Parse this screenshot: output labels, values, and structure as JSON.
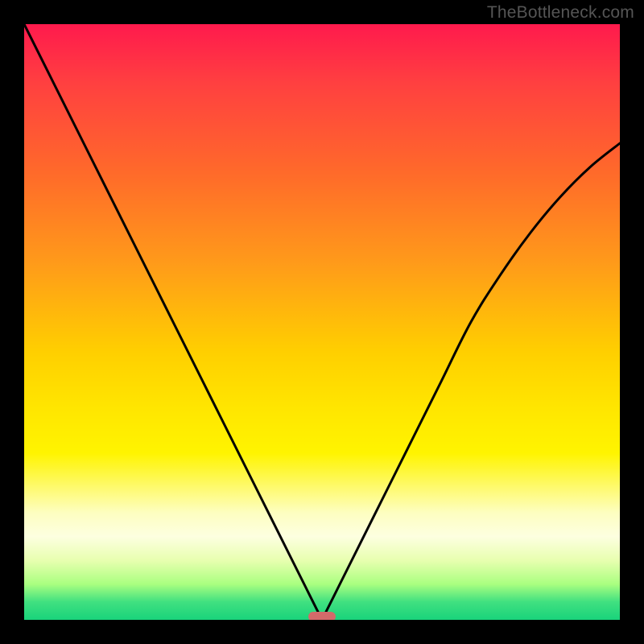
{
  "watermark": "TheBottleneck.com",
  "chart_data": {
    "type": "line",
    "title": "",
    "xlabel": "",
    "ylabel": "",
    "xlim": [
      0,
      100
    ],
    "ylim": [
      0,
      100
    ],
    "series": [
      {
        "name": "left-branch",
        "x": [
          0,
          5,
          10,
          15,
          20,
          25,
          30,
          35,
          40,
          45,
          48,
          50
        ],
        "values": [
          100,
          90,
          80,
          70,
          60,
          50,
          40,
          30,
          20,
          10,
          4,
          0
        ]
      },
      {
        "name": "right-branch",
        "x": [
          50,
          52,
          55,
          60,
          65,
          70,
          75,
          80,
          85,
          90,
          95,
          100
        ],
        "values": [
          0,
          4,
          10,
          20,
          30,
          40,
          50,
          58,
          65,
          71,
          76,
          80
        ]
      }
    ],
    "marker": {
      "x": 50,
      "y": 0
    },
    "gradient_stops": [
      {
        "pct": 0,
        "color": "#ff1a4d"
      },
      {
        "pct": 50,
        "color": "#ffe000"
      },
      {
        "pct": 90,
        "color": "#f0ffb0"
      },
      {
        "pct": 100,
        "color": "#19d37b"
      }
    ]
  }
}
